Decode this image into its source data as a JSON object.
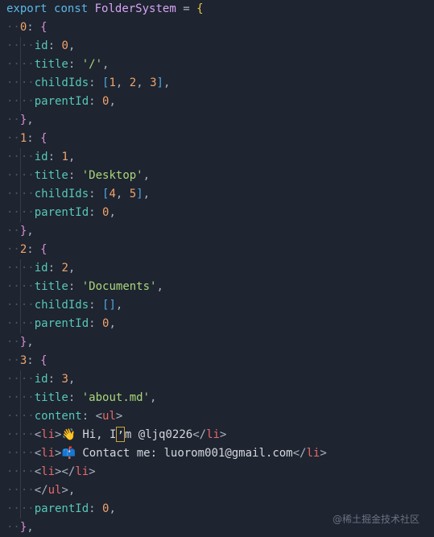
{
  "editor": {
    "lines": [
      "export const FolderSystem = {",
      "  0: {",
      "    id: 0,",
      "    title: '/',",
      "    childIds: [1, 2, 3],",
      "    parentId: 0,",
      "  },",
      "  1: {",
      "    id: 1,",
      "    title: 'Desktop',",
      "    childIds: [4, 5],",
      "    parentId: 0,",
      "  },",
      "  2: {",
      "    id: 2,",
      "    title: 'Documents',",
      "    childIds: [],",
      "    parentId: 0,",
      "  },",
      "  3: {",
      "    id: 3,",
      "    title: 'about.md',",
      "    content: <ul>",
      "    <li>👋 Hi, I’m @ljq0226</li>",
      "    <li>📫 Contact me: luorom001@gmail.com</li>",
      "    <li></li>",
      "    </ul>,",
      "    parentId: 0,",
      "  },"
    ]
  },
  "watermark": "@稀土掘金技术社区"
}
